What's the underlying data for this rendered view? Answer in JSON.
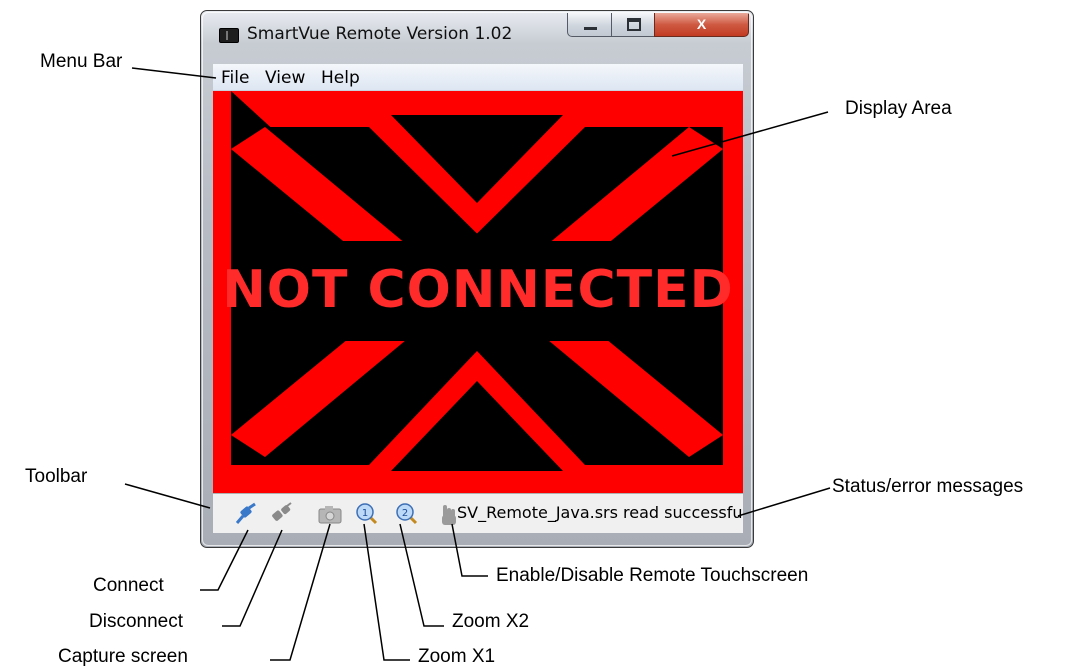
{
  "window": {
    "title": "SmartVue Remote Version 1.02",
    "controls": {
      "minimize": "minimize-icon",
      "maximize": "maximize-icon",
      "close": "close-icon",
      "close_glyph": "X"
    }
  },
  "menu": {
    "items": [
      "File",
      "View",
      "Help"
    ]
  },
  "display": {
    "message": "NOT CONNECTED",
    "background_color": "#ff0000",
    "band_color": "#000000"
  },
  "toolbar": {
    "icons": [
      "connect-icon",
      "disconnect-icon",
      "camera-icon",
      "zoom-x1-icon",
      "zoom-x2-icon",
      "touchscreen-hand-icon"
    ],
    "status_message": "SV_Remote_Java.srs read successfully"
  },
  "annotations": {
    "menu_bar": "Menu Bar",
    "display_area": "Display Area",
    "toolbar": "Toolbar",
    "status": "Status/error messages",
    "connect": "Connect",
    "disconnect": "Disconnect",
    "capture": "Capture screen",
    "zoom_x1": "Zoom X1",
    "zoom_x2": "Zoom X2",
    "touchscreen": "Enable/Disable Remote Touchscreen"
  }
}
